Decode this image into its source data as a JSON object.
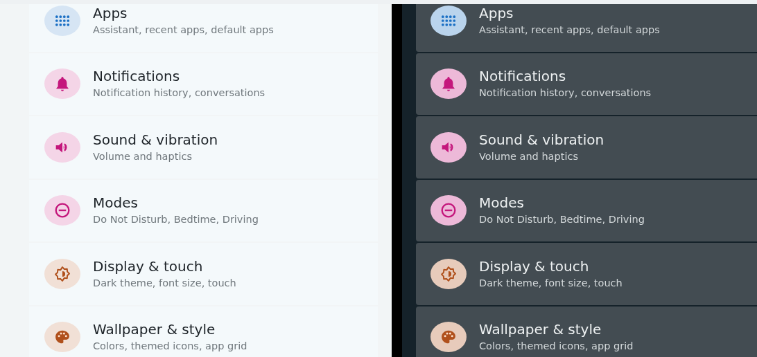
{
  "panels": [
    {
      "kind": "light",
      "items": [
        {
          "kind": "apps",
          "color": "#1a6fc4",
          "title": "Apps",
          "subtitle": "Assistant, recent apps, default apps"
        },
        {
          "kind": "notifications",
          "color": "#c4177c",
          "title": "Notifications",
          "subtitle": "Notification history, conversations"
        },
        {
          "kind": "sound",
          "color": "#c4177c",
          "title": "Sound & vibration",
          "subtitle": "Volume and haptics"
        },
        {
          "kind": "modes",
          "color": "#c4177c",
          "title": "Modes",
          "subtitle": "Do Not Disturb, Bedtime, Driving"
        },
        {
          "kind": "display",
          "color": "#b0501c",
          "title": "Display & touch",
          "subtitle": "Dark theme, font size, touch"
        },
        {
          "kind": "wallpaper",
          "color": "#b0501c",
          "title": "Wallpaper & style",
          "subtitle": "Colors, themed icons, app grid"
        }
      ]
    },
    {
      "kind": "dark",
      "items": [
        {
          "kind": "apps",
          "color": "#1a6fc4",
          "title": "Apps",
          "subtitle": "Assistant, recent apps, default apps"
        },
        {
          "kind": "notifications",
          "color": "#c4177c",
          "title": "Notifications",
          "subtitle": "Notification history, conversations"
        },
        {
          "kind": "sound",
          "color": "#c4177c",
          "title": "Sound & vibration",
          "subtitle": "Volume and haptics"
        },
        {
          "kind": "modes",
          "color": "#c4177c",
          "title": "Modes",
          "subtitle": "Do Not Disturb, Bedtime, Driving"
        },
        {
          "kind": "display",
          "color": "#b0501c",
          "title": "Display & touch",
          "subtitle": "Dark theme, font size, touch"
        },
        {
          "kind": "wallpaper",
          "color": "#b0501c",
          "title": "Wallpaper & style",
          "subtitle": "Colors, themed icons, app grid"
        }
      ]
    }
  ]
}
